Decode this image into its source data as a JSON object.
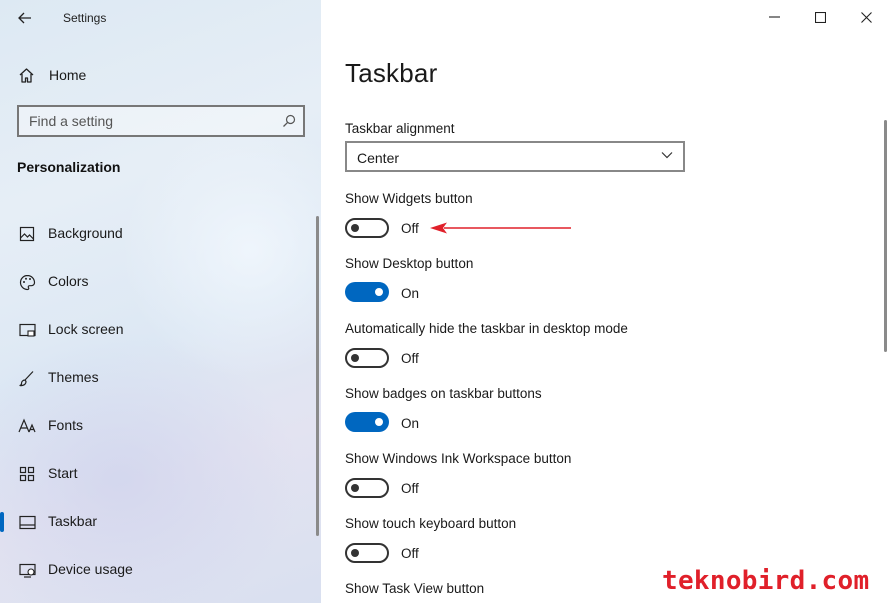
{
  "window": {
    "app_title": "Settings"
  },
  "sidebar": {
    "home_label": "Home",
    "search_placeholder": "Find a setting",
    "section_title": "Personalization",
    "items": [
      {
        "label": "Background",
        "icon": "background-image-icon"
      },
      {
        "label": "Colors",
        "icon": "palette-icon"
      },
      {
        "label": "Lock screen",
        "icon": "lock-screen-icon"
      },
      {
        "label": "Themes",
        "icon": "brush-icon"
      },
      {
        "label": "Fonts",
        "icon": "fonts-icon"
      },
      {
        "label": "Start",
        "icon": "start-grid-icon"
      },
      {
        "label": "Taskbar",
        "icon": "taskbar-icon",
        "active": true
      },
      {
        "label": "Device usage",
        "icon": "device-usage-icon"
      }
    ]
  },
  "main": {
    "title": "Taskbar",
    "alignment": {
      "label": "Taskbar alignment",
      "value": "Center"
    },
    "settings": [
      {
        "label": "Show Widgets button",
        "state": "Off",
        "on": false
      },
      {
        "label": "Show Desktop button",
        "state": "On",
        "on": true
      },
      {
        "label": "Automatically hide the taskbar in desktop mode",
        "state": "Off",
        "on": false
      },
      {
        "label": "Show badges on taskbar buttons",
        "state": "On",
        "on": true
      },
      {
        "label": "Show Windows Ink Workspace button",
        "state": "Off",
        "on": false
      },
      {
        "label": "Show touch keyboard button",
        "state": "Off",
        "on": false
      },
      {
        "label": "Show Task View button"
      }
    ]
  },
  "watermark": "teknobird.com",
  "colors": {
    "accent": "#0067c0",
    "annotation": "#e0202a"
  }
}
